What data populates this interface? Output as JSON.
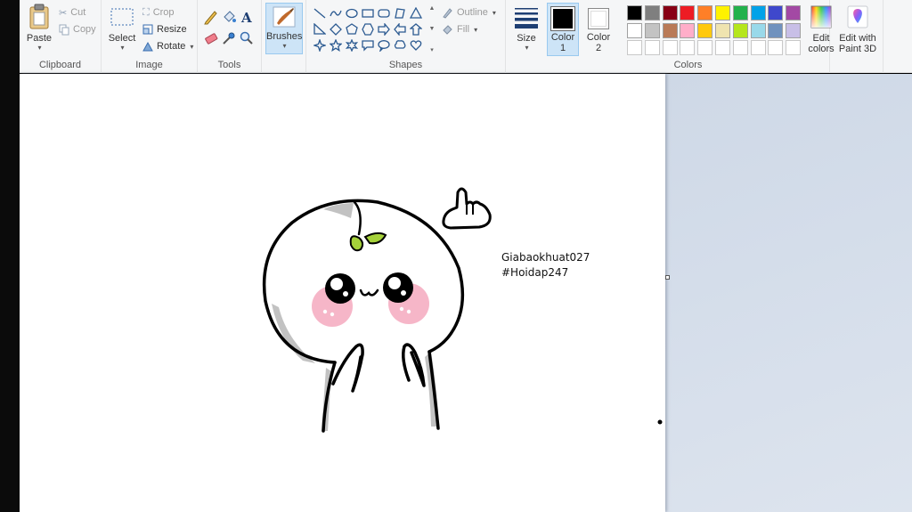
{
  "ribbon": {
    "clipboard": {
      "label": "Clipboard",
      "paste": "Paste",
      "cut": "Cut",
      "copy": "Copy"
    },
    "image": {
      "label": "Image",
      "select": "Select",
      "crop": "Crop",
      "resize": "Resize",
      "rotate": "Rotate"
    },
    "tools": {
      "label": "Tools"
    },
    "brushes": {
      "label": "Brushes"
    },
    "shapes": {
      "label": "Shapes",
      "outline": "Outline",
      "fill": "Fill"
    },
    "size": {
      "label": "Size"
    },
    "colors": {
      "label": "Colors",
      "color1_label": "Color 1",
      "color1_line1": "Color",
      "color1_line2": "1",
      "color2_line1": "Color",
      "color2_line2": "2",
      "edit_line1": "Edit",
      "edit_line2": "colors",
      "color1_value": "#000000",
      "color2_value": "#ffffff",
      "palette_row1": [
        "#000000",
        "#7f7f7f",
        "#880015",
        "#ed1c24",
        "#ff7f27",
        "#fff200",
        "#22b14c",
        "#00a2e8",
        "#3f48cc",
        "#a349a4"
      ],
      "palette_row2": [
        "#ffffff",
        "#c3c3c3",
        "#b97a57",
        "#ffaec9",
        "#ffc90e",
        "#efe4b0",
        "#b5e61d",
        "#99d9ea",
        "#7092be",
        "#c8bfe7"
      ],
      "palette_row3": [
        "#ffffff",
        "#ffffff",
        "#ffffff",
        "#ffffff",
        "#ffffff",
        "#ffffff",
        "#ffffff",
        "#ffffff",
        "#ffffff",
        "#ffffff"
      ]
    },
    "paint3d": {
      "line1": "Edit with",
      "line2": "Paint 3D"
    }
  },
  "canvas": {
    "caption_line1": "Giabaokhuat027",
    "caption_line2": "#Hoidap247"
  }
}
